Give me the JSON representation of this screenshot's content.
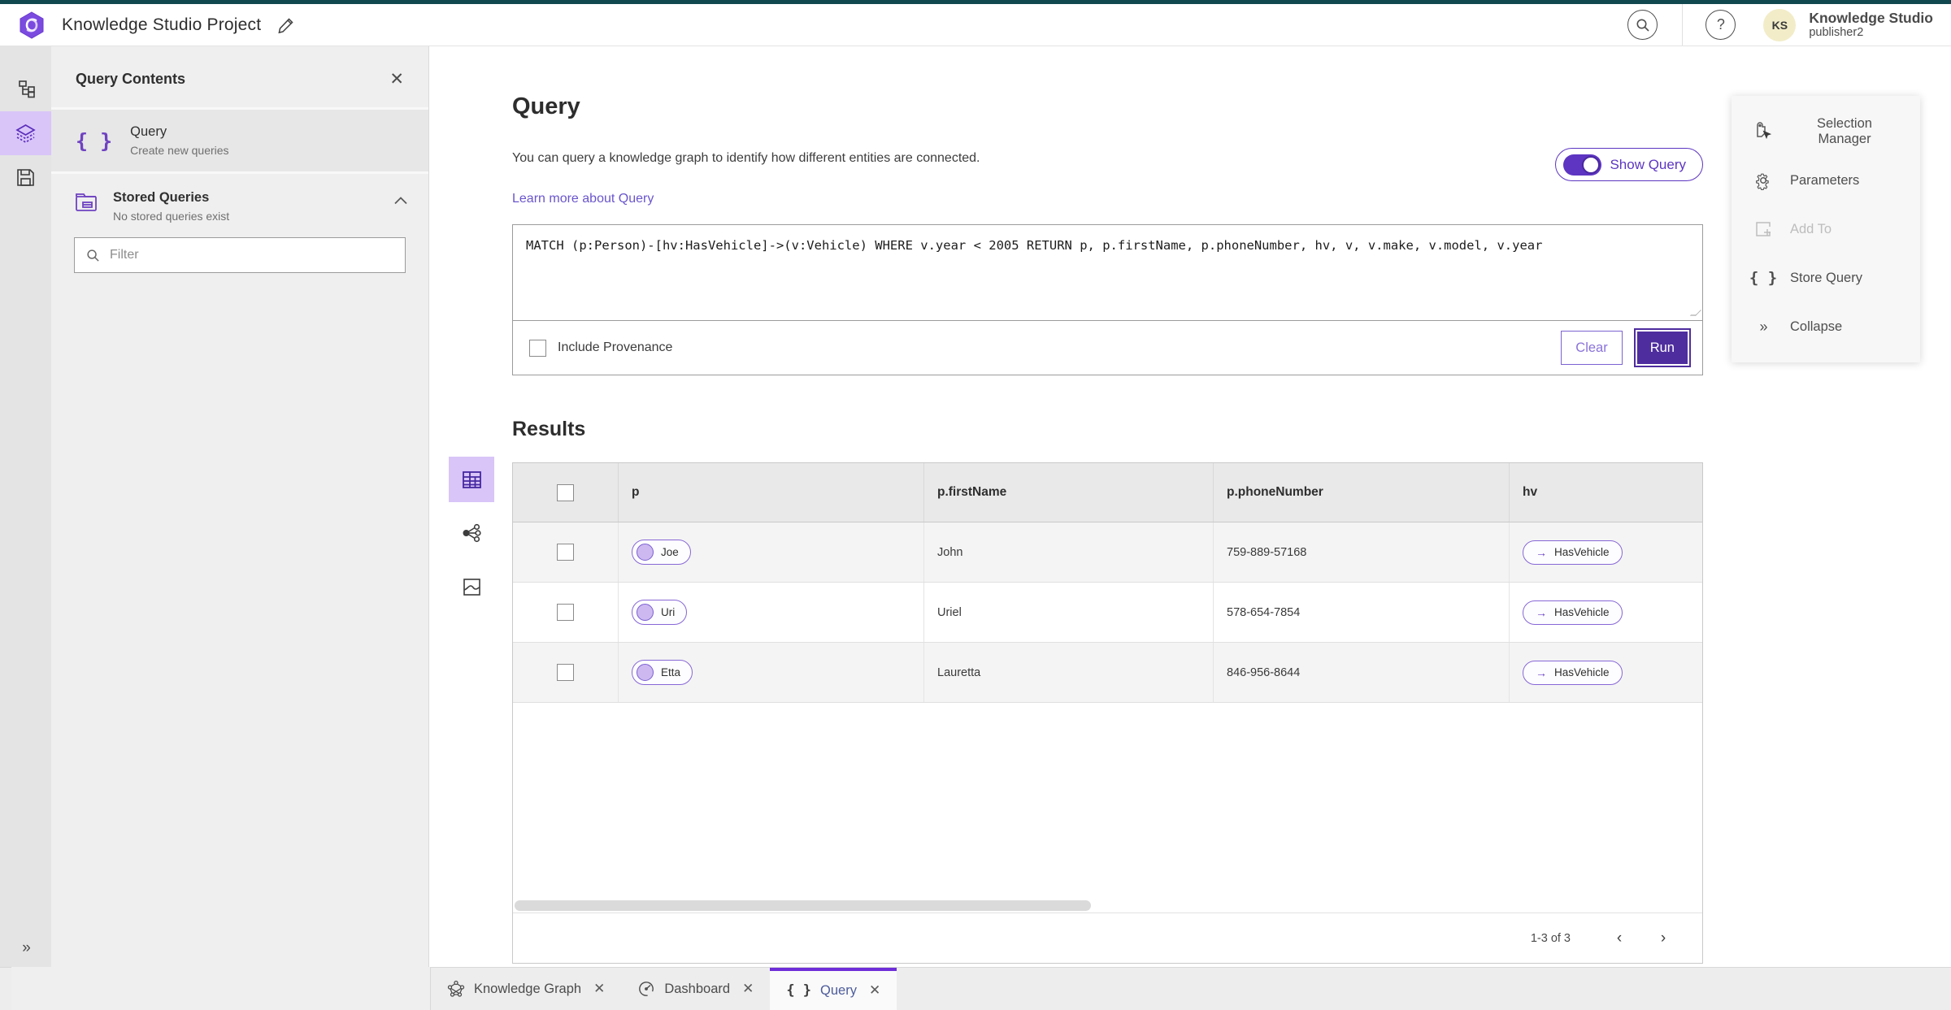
{
  "colors": {
    "top_strip": "#11474f",
    "accent_purple": "#5d35c2",
    "run_button": "#4e2d9e",
    "active_tab_border": "#6e2ed8",
    "rail_highlight": "#d9c5f8",
    "avatar_bg": "#f2ecc8",
    "link": "#6a55cc",
    "pill_border": "#8767d6"
  },
  "header": {
    "title": "Knowledge Studio Project",
    "user": {
      "initials": "KS",
      "name": "Knowledge Studio",
      "subtitle": "publisher2"
    }
  },
  "contents_panel": {
    "title": "Query Contents",
    "query_item": {
      "title": "Query",
      "subtitle": "Create new queries"
    },
    "stored_queries": {
      "title": "Stored Queries",
      "subtitle": "No stored queries exist"
    },
    "filter_placeholder": "Filter"
  },
  "query_section": {
    "title": "Query",
    "description": "You can query a knowledge graph to identify how different entities are connected.",
    "learn_more": "Learn more about Query",
    "show_query_label": "Show Query",
    "query_text": "MATCH (p:Person)-[hv:HasVehicle]->(v:Vehicle) WHERE v.year < 2005 RETURN p, p.firstName, p.phoneNumber, hv, v, v.make, v.model, v.year",
    "include_provenance_label": "Include Provenance",
    "clear_label": "Clear",
    "run_label": "Run"
  },
  "results": {
    "title": "Results",
    "columns": [
      "p",
      "p.firstName",
      "p.phoneNumber",
      "hv"
    ],
    "rows": [
      {
        "p": "Joe",
        "firstName": "John",
        "phoneNumber": "759-889-57168",
        "hv": "HasVehicle"
      },
      {
        "p": "Uri",
        "firstName": "Uriel",
        "phoneNumber": "578-654-7854",
        "hv": "HasVehicle"
      },
      {
        "p": "Etta",
        "firstName": "Lauretta",
        "phoneNumber": "846-956-8644",
        "hv": "HasVehicle"
      }
    ],
    "pagination": "1-3 of 3"
  },
  "tools_panel": {
    "items": [
      {
        "label": "Selection Manager",
        "disabled": false
      },
      {
        "label": "Parameters",
        "disabled": false
      },
      {
        "label": "Add To",
        "disabled": true
      },
      {
        "label": "Store Query",
        "disabled": false
      },
      {
        "label": "Collapse",
        "disabled": false
      }
    ]
  },
  "tabs": [
    {
      "label": "Knowledge Graph",
      "active": false
    },
    {
      "label": "Dashboard",
      "active": false
    },
    {
      "label": "Query",
      "active": true
    }
  ]
}
